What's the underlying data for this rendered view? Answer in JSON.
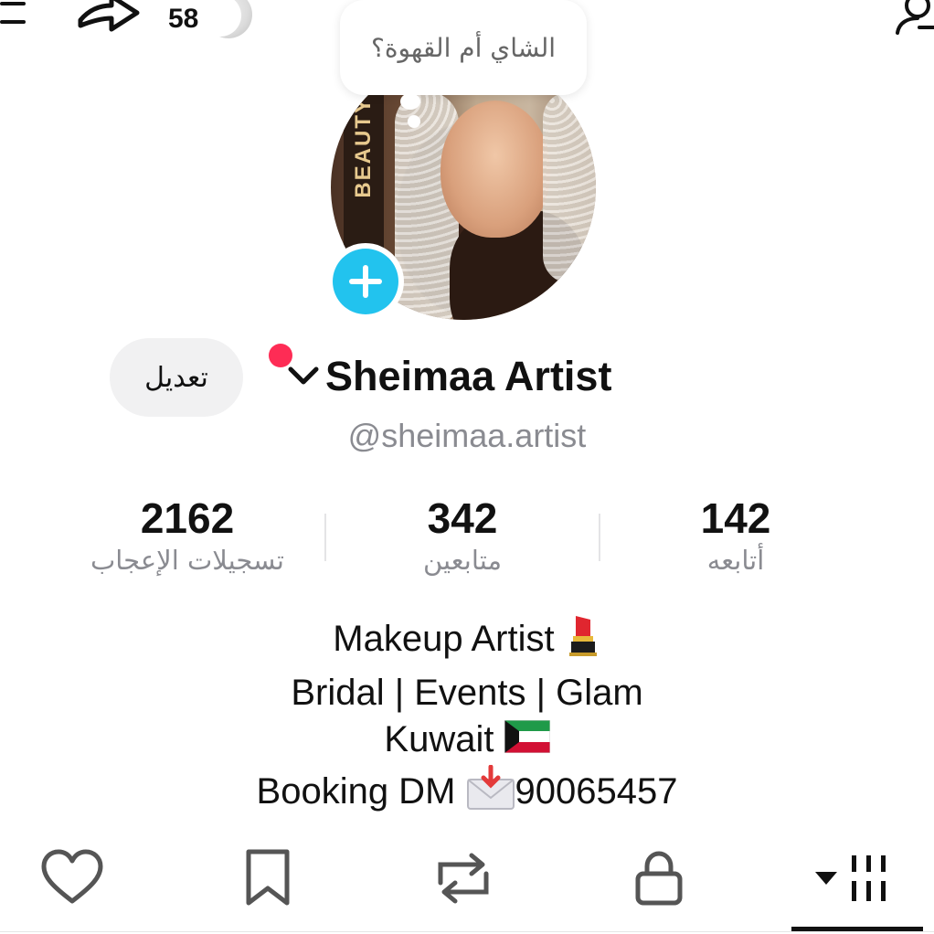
{
  "top_bar": {
    "counter_value": "58",
    "icons": [
      "menu-icon",
      "share-icon",
      "person-icon"
    ]
  },
  "thought_bubble": {
    "text": "الشاي أم القهوة؟"
  },
  "profile": {
    "name": "Sheimaa Artist",
    "handle": "@sheimaa.artist",
    "edit_label": "تعديل",
    "avatar_overlay_text": "BEAUTY"
  },
  "stats": [
    {
      "value": "2162",
      "label": "تسجيلات الإعجاب"
    },
    {
      "value": "342",
      "label": "متابعين"
    },
    {
      "value": "142",
      "label": "أتابعه"
    }
  ],
  "bio": {
    "line1": "Makeup Artist",
    "line2": "Bridal | Events | Glam",
    "line3": "Kuwait",
    "line4_prefix": "Booking DM",
    "line4_number": "90065457"
  },
  "tabs": [
    {
      "icon": "heart-icon"
    },
    {
      "icon": "bookmark-icon"
    },
    {
      "icon": "repost-icon"
    },
    {
      "icon": "lock-icon"
    },
    {
      "icon": "grid-icon",
      "selected": true
    }
  ],
  "colors": {
    "accent_blue": "#22c3ee",
    "notification_red": "#fe2c55",
    "secondary_text": "#8a8b91",
    "edit_button_bg": "#f1f1f2"
  }
}
